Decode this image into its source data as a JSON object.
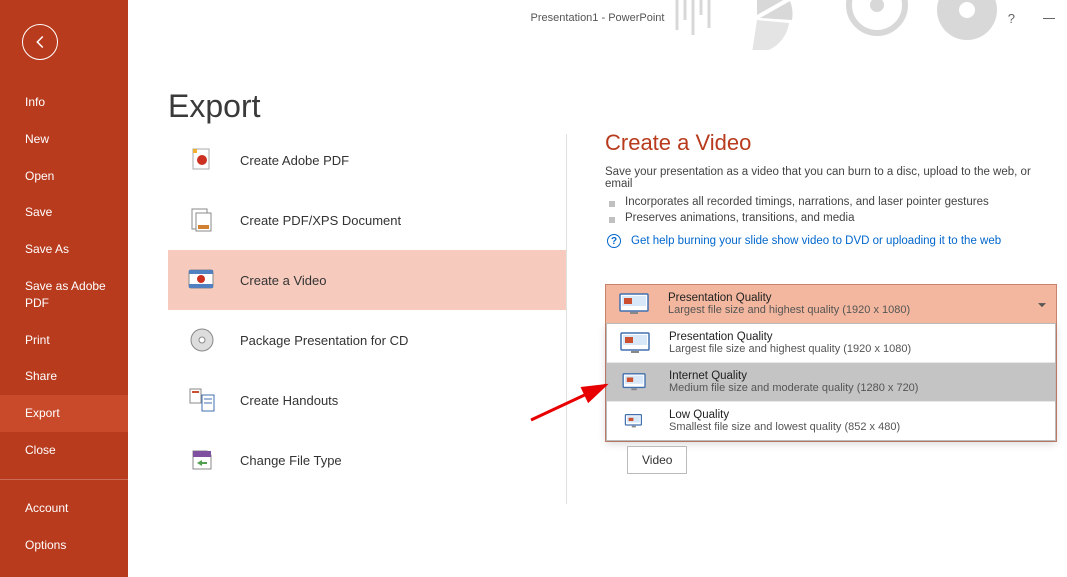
{
  "window": {
    "title": "Presentation1 - PowerPoint",
    "help": "?"
  },
  "sidebar": {
    "items": [
      {
        "label": "Info"
      },
      {
        "label": "New"
      },
      {
        "label": "Open"
      },
      {
        "label": "Save"
      },
      {
        "label": "Save As"
      },
      {
        "label": "Save as Adobe PDF"
      },
      {
        "label": "Print"
      },
      {
        "label": "Share"
      },
      {
        "label": "Export"
      },
      {
        "label": "Close"
      }
    ],
    "footer": [
      {
        "label": "Account"
      },
      {
        "label": "Options"
      }
    ]
  },
  "page": {
    "title": "Export",
    "options": [
      {
        "label": "Create Adobe PDF",
        "icon": "adobe-pdf"
      },
      {
        "label": "Create PDF/XPS Document",
        "icon": "pdf-xps"
      },
      {
        "label": "Create a Video",
        "icon": "video",
        "selected": true
      },
      {
        "label": "Package Presentation for CD",
        "icon": "cd"
      },
      {
        "label": "Create Handouts",
        "icon": "handouts"
      },
      {
        "label": "Change File Type",
        "icon": "filetype"
      }
    ]
  },
  "details": {
    "title": "Create a Video",
    "subtitle": "Save your presentation as a video that you can burn to a disc, upload to the web, or email",
    "bullets": [
      "Incorporates all recorded timings, narrations, and laser pointer gestures",
      "Preserves animations, transitions, and media"
    ],
    "help_link": "Get help burning your slide show video to DVD or uploading it to the web"
  },
  "quality": {
    "selected": {
      "title": "Presentation Quality",
      "desc": "Largest file size and highest quality (1920 x 1080)"
    },
    "options": [
      {
        "title": "Presentation Quality",
        "desc": "Largest file size and highest quality (1920 x 1080)"
      },
      {
        "title": "Internet Quality",
        "desc": "Medium file size and moderate quality (1280 x 720)",
        "hover": true
      },
      {
        "title": "Low Quality",
        "desc": "Smallest file size and lowest quality (852 x 480)"
      }
    ]
  },
  "actions": {
    "video_button": "Video"
  }
}
